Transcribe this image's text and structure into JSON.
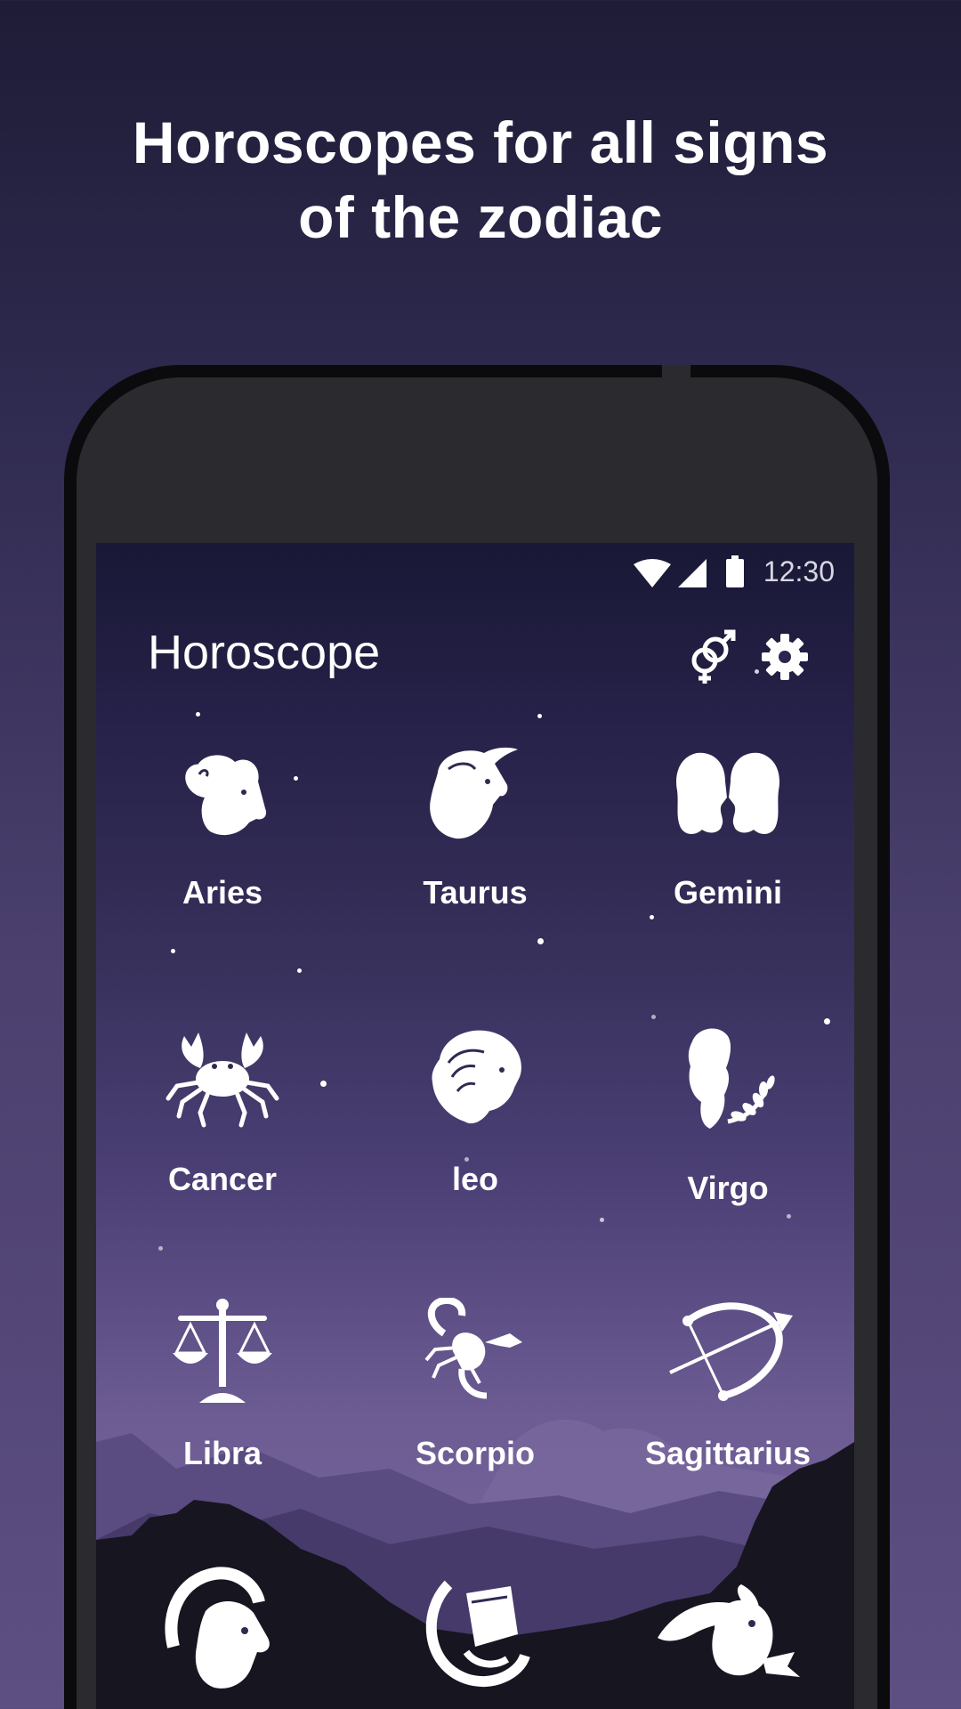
{
  "promo": {
    "line1": "Horoscopes for all signs",
    "line2": "of the zodiac"
  },
  "status_bar": {
    "time": "12:30",
    "icons": [
      "wifi-icon",
      "signal-icon",
      "battery-icon"
    ]
  },
  "app": {
    "title": "Horoscope",
    "actions": [
      {
        "icon": "gender-compatibility-icon"
      },
      {
        "icon": "gear-icon"
      }
    ]
  },
  "signs": [
    {
      "label": "Aries",
      "icon": "aries-ram-icon"
    },
    {
      "label": "Taurus",
      "icon": "taurus-bull-icon"
    },
    {
      "label": "Gemini",
      "icon": "gemini-twins-icon"
    },
    {
      "label": "Cancer",
      "icon": "cancer-crab-icon"
    },
    {
      "label": "leo",
      "icon": "leo-lion-icon"
    },
    {
      "label": "Virgo",
      "icon": "virgo-maiden-icon"
    },
    {
      "label": "Libra",
      "icon": "libra-scales-icon"
    },
    {
      "label": "Scorpio",
      "icon": "scorpio-scorpion-icon"
    },
    {
      "label": "Sagittarius",
      "icon": "sagittarius-bow-icon"
    },
    {
      "label": "",
      "icon": "capricorn-goat-icon"
    },
    {
      "label": "",
      "icon": "aquarius-water-icon"
    },
    {
      "label": "",
      "icon": "pisces-fish-icon"
    }
  ],
  "colors": {
    "background_top": "#1e1c36",
    "background_bottom": "#5e4f83",
    "screen_top": "#191836",
    "screen_bottom": "#7b6aa0",
    "phone_body": "#2b2b2f",
    "icon_color": "#ffffff"
  }
}
